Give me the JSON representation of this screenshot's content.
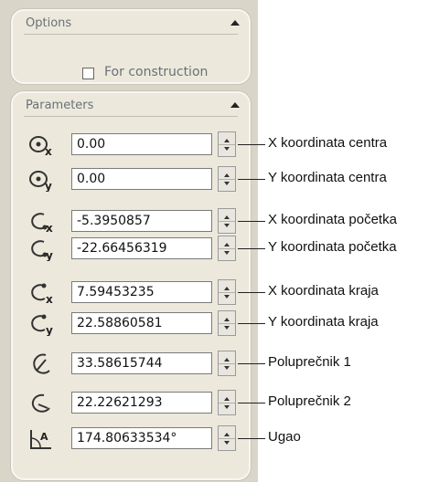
{
  "options": {
    "title": "Options",
    "checkbox_label": "For construction",
    "checkbox_checked": false
  },
  "parameters": {
    "title": "Parameters",
    "fields": [
      {
        "icon": "center-x-icon",
        "value": "0.00",
        "callout": "X koordinata centra"
      },
      {
        "icon": "center-y-icon",
        "value": "0.00",
        "callout": "Y koordinata centra"
      },
      {
        "icon": "start-x-icon",
        "value": "-5.3950857",
        "callout": "X koordinata početka"
      },
      {
        "icon": "start-y-icon",
        "value": "-22.66456319",
        "callout": "Y koordinata početka"
      },
      {
        "icon": "end-x-icon",
        "value": "7.59453235",
        "callout": "X koordinata kraja"
      },
      {
        "icon": "end-y-icon",
        "value": "22.58860581",
        "callout": "Y koordinata kraja"
      },
      {
        "icon": "radius1-icon",
        "value": "33.58615744",
        "callout": "Poluprečnik 1"
      },
      {
        "icon": "radius2-icon",
        "value": "22.22621293",
        "callout": "Poluprečnik 2"
      },
      {
        "icon": "angle-icon",
        "value": "174.80633534°",
        "callout": "Ugao"
      }
    ]
  }
}
